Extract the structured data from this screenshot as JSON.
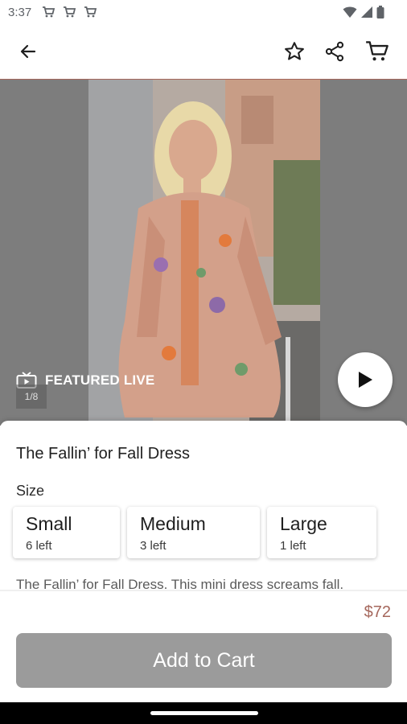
{
  "status_bar": {
    "time": "3:37",
    "notification_icons": [
      "cart-icon",
      "cart-icon",
      "cart-icon"
    ],
    "right_icons": [
      "wifi-icon",
      "signal-icon",
      "battery-icon"
    ]
  },
  "toolbar": {
    "back_icon": "arrow-left-icon",
    "actions": [
      "star-icon",
      "share-icon",
      "cart-icon"
    ]
  },
  "hero": {
    "badge_label": "FEATURED LIVE",
    "image_counter": "1/8"
  },
  "product": {
    "title": "The Fallin’ for Fall Dress",
    "size_label": "Size",
    "sizes": [
      {
        "name": "Small",
        "stock": "6 left"
      },
      {
        "name": "Medium",
        "stock": "3 left"
      },
      {
        "name": "Large",
        "stock": "1 left"
      }
    ],
    "description": "The Fallin’ for Fall Dress. This mini dress screams fall.",
    "price": "$72"
  },
  "cta": {
    "add_to_cart_label": "Add to Cart"
  },
  "colors": {
    "accent": "#a5675c",
    "button_disabled": "#9b9b9b"
  }
}
